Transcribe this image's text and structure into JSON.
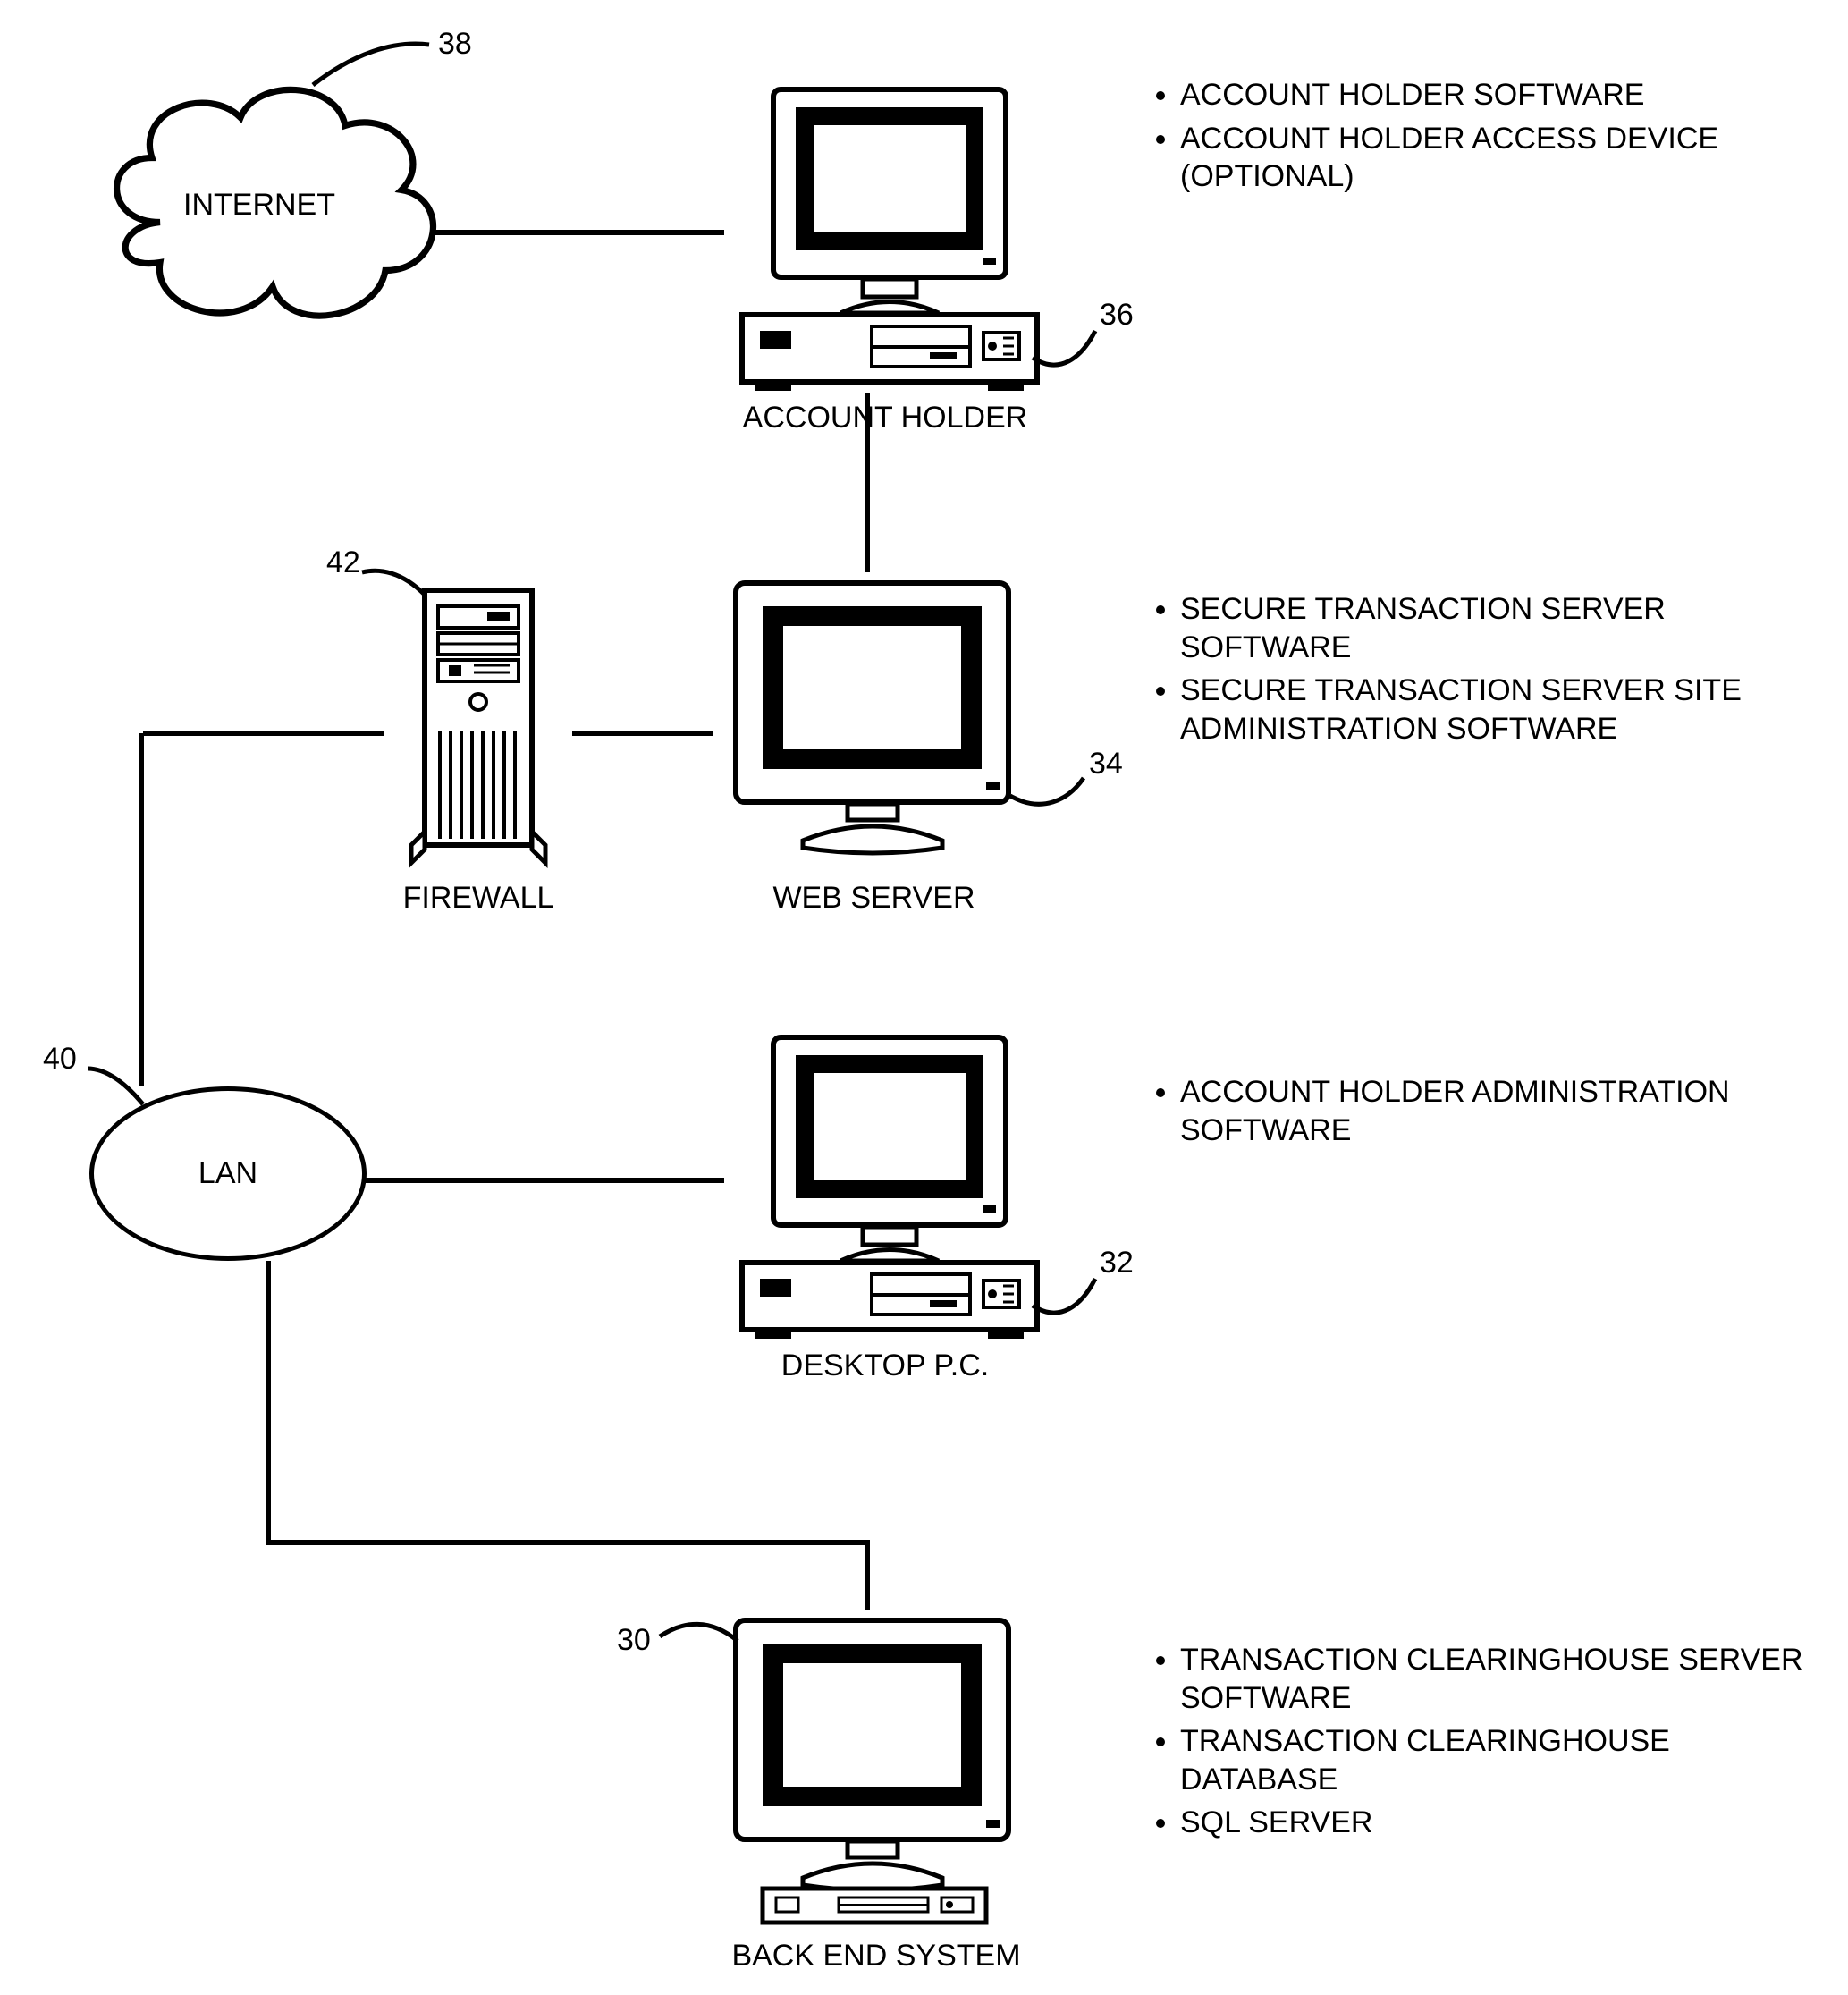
{
  "nodes": {
    "internet": {
      "label": "INTERNET",
      "ref": "38"
    },
    "account_holder": {
      "label": "ACCOUNT HOLDER",
      "ref": "36"
    },
    "firewall": {
      "label": "FIREWALL",
      "ref": "42"
    },
    "web_server": {
      "label": "WEB SERVER",
      "ref": "34"
    },
    "lan": {
      "label": "LAN",
      "ref": "40"
    },
    "desktop_pc": {
      "label": "DESKTOP P.C.",
      "ref": "32"
    },
    "back_end": {
      "label": "BACK END SYSTEM",
      "ref": "30"
    }
  },
  "annotations": {
    "account_holder": [
      "ACCOUNT HOLDER SOFTWARE",
      "ACCOUNT HOLDER ACCESS DEVICE (OPTIONAL)"
    ],
    "web_server": [
      "SECURE TRANSACTION SERVER SOFTWARE",
      "SECURE TRANSACTION SERVER SITE ADMINISTRATION SOFTWARE"
    ],
    "desktop_pc": [
      "ACCOUNT HOLDER ADMINISTRATION SOFTWARE"
    ],
    "back_end": [
      "TRANSACTION CLEARINGHOUSE SERVER SOFTWARE",
      "TRANSACTION CLEARINGHOUSE DATABASE",
      "SQL SERVER"
    ]
  }
}
